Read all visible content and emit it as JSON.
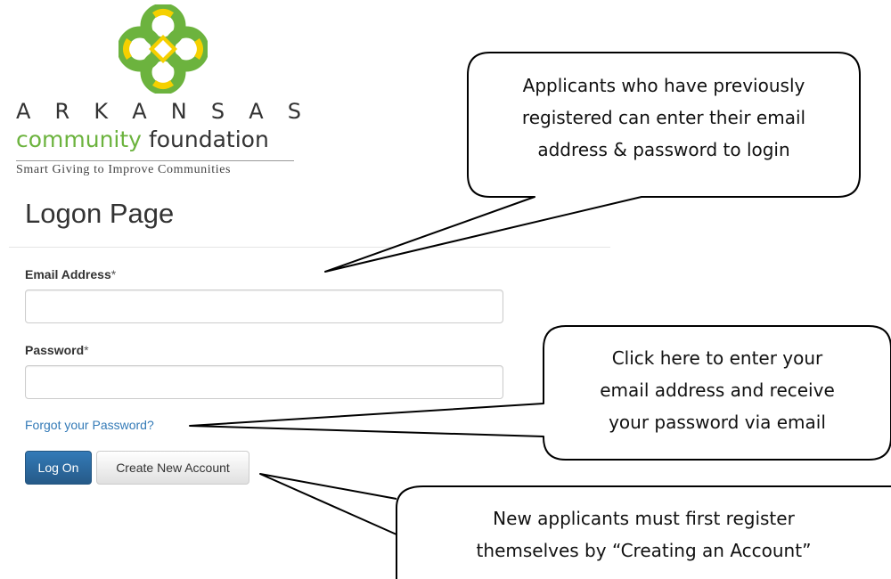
{
  "logo": {
    "name_letters": [
      "A",
      "R",
      "K",
      "A",
      "N",
      "S",
      "A",
      "S"
    ],
    "community": "community",
    "foundation": "foundation",
    "tagline": "Smart Giving to Improve Communities",
    "colors": {
      "green": "#6cb33e",
      "yellow": "#f5d000"
    }
  },
  "page": {
    "title": "Logon Page"
  },
  "form": {
    "email": {
      "label": "Email Address",
      "required_mark": "*",
      "value": "",
      "placeholder": ""
    },
    "password": {
      "label": "Password",
      "required_mark": "*",
      "value": "",
      "placeholder": ""
    },
    "forgot_link": "Forgot your Password?",
    "logon_button": "Log On",
    "create_account_button": "Create New Account"
  },
  "callouts": {
    "login": {
      "lines": [
        "Applicants who have previously",
        "registered can enter their email",
        "address & password to login"
      ]
    },
    "forgot": {
      "lines": [
        "Click here to enter your",
        "email address and receive",
        "your password via email"
      ]
    },
    "create": {
      "lines": [
        "New applicants must first register",
        "themselves by “Creating an Account”"
      ]
    }
  },
  "colors": {
    "link": "#337ab7",
    "primary_button": "#2b6da8"
  }
}
